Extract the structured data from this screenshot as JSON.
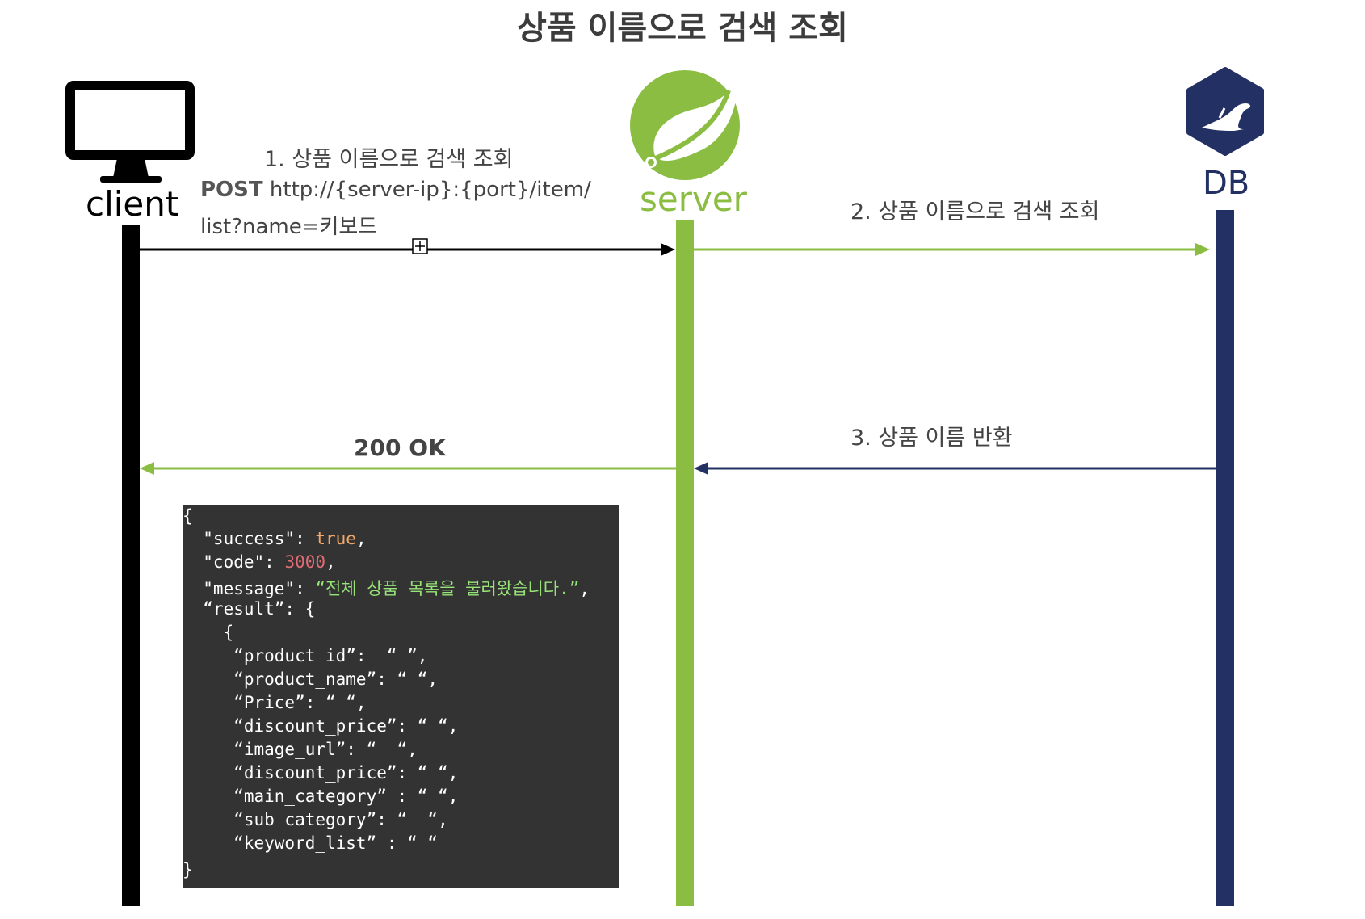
{
  "title": "상품 이름으로 검색 조회",
  "actors": {
    "client": "client",
    "server": "server",
    "db": "DB"
  },
  "messages": {
    "m1_label": "1. 상품 이름으로 검색 조회",
    "m1_method": "POST",
    "m1_url_part1": " http://{server-ip}:{port}/item/",
    "m1_url_part2": "list?name=키보드",
    "m2_label": "2. 상품 이름으로 검색 조회",
    "m3_label": "3. 상품 이름 반환",
    "m4_label": "200 OK"
  },
  "response": {
    "open": "{",
    "l1_key": "  \"success\": ",
    "l1_val": "true",
    "l1_end": ",",
    "l2_key": "  \"code\": ",
    "l2_val": "3000",
    "l2_end": ",",
    "l3_key": "  \"message\": ",
    "l3_val": "“전체 상품 목록을 불러왔습니다.”",
    "l3_end": ",",
    "l4": "  “result”: {",
    "l5": "    {",
    "l6": "     “product_id”:  “ ”,",
    "l7": "     “product_name”: “ “,",
    "l8": "     “Price”: “ “,",
    "l9": "     “discount_price”: “ “,",
    "l10": "     “image_url”: “  “,",
    "l11": "     “discount_price”: “ “,",
    "l12": "     “main_category” : “ “,",
    "l13": "     “sub_category”: “  “,",
    "l14": "     “keyword_list” : “ “",
    "close": "}"
  },
  "colors": {
    "client": "#000000",
    "server": "#8bbd43",
    "db": "#233063",
    "code_bg": "#333333"
  },
  "icons": {
    "client": "monitor-icon",
    "server": "spring-leaf-icon",
    "db": "mariadb-seal-icon"
  }
}
